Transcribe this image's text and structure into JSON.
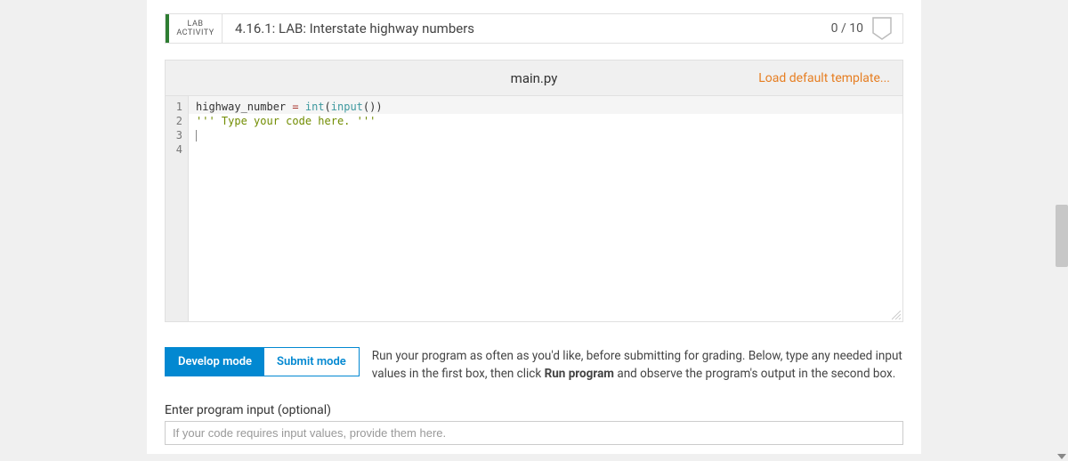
{
  "header": {
    "badge_line1": "LAB",
    "badge_line2": "ACTIVITY",
    "title": "4.16.1: LAB: Interstate highway numbers",
    "score": "0 / 10"
  },
  "filebar": {
    "filename": "main.py",
    "load_link": "Load default template..."
  },
  "editor": {
    "gutter": [
      "1",
      "2",
      "3",
      "4"
    ],
    "lines": {
      "l1_var": "highway_number",
      "l1_op": " = ",
      "l1_fn_int": "int",
      "l1_fn_input": "input",
      "l2": "",
      "l3_q1": "''' ",
      "l3_txt": "Type your code here.",
      "l3_q2": " '''"
    }
  },
  "modes": {
    "develop": "Develop mode",
    "submit": "Submit mode",
    "help_pre": "Run your program as often as you'd like, before submitting for grading. Below, type any needed input values in the first box, then click ",
    "help_bold": "Run program",
    "help_post": " and observe the program's output in the second box."
  },
  "input": {
    "label": "Enter program input (optional)",
    "placeholder": "If your code requires input values, provide them here."
  }
}
